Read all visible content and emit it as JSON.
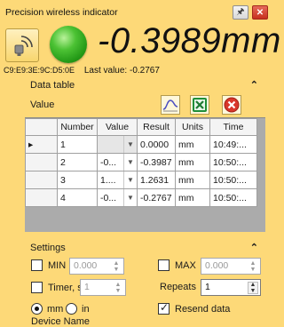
{
  "window": {
    "title": "Precision wireless indicator",
    "pin_glyph": "🖈",
    "close_glyph": "✕"
  },
  "header": {
    "big_value": "-0.3989mm",
    "mac_address": "C9:E9:3E:9C:D5:0E",
    "last_value_label": "Last value:",
    "last_value": "-0.2767",
    "status_led_color": "#2fa81f"
  },
  "data_table": {
    "section_title": "Data table",
    "collapse_glyph": "⌃",
    "value_label": "Value",
    "tools": [
      "chart-icon",
      "excel-export-icon",
      "clear-icon"
    ],
    "columns": [
      "Number",
      "Value",
      "Result",
      "Units",
      "Time"
    ],
    "rows": [
      {
        "marker": "▸",
        "number": "1",
        "value": "",
        "result": "0.0000",
        "units": "mm",
        "time": "10:49:..."
      },
      {
        "marker": "",
        "number": "2",
        "value": "-0...",
        "result": "-0.3987",
        "units": "mm",
        "time": "10:50:..."
      },
      {
        "marker": "",
        "number": "3",
        "value": "1....",
        "result": "1.2631",
        "units": "mm",
        "time": "10:50:..."
      },
      {
        "marker": "",
        "number": "4",
        "value": "-0...",
        "result": "-0.2767",
        "units": "mm",
        "time": "10:50:..."
      }
    ]
  },
  "settings": {
    "section_title": "Settings",
    "collapse_glyph": "⌃",
    "min_label": "MIN",
    "min_value": "0.000",
    "max_label": "MAX",
    "max_value": "0.000",
    "timer_label": "Timer, s",
    "timer_value": "1",
    "repeats_label": "Repeats",
    "repeats_value": "1",
    "unit_mm": "mm",
    "unit_in": "in",
    "resend_label": "Resend data",
    "resend_checked": true,
    "device_name_label": "Device Name"
  }
}
